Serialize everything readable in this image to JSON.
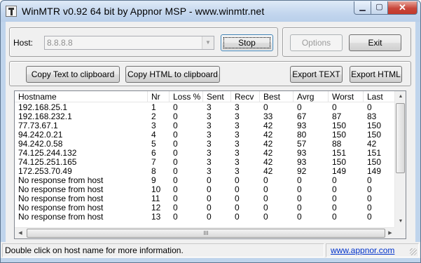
{
  "window": {
    "title": "WinMTR v0.92 64 bit by Appnor MSP - www.winmtr.net",
    "controls": {
      "minimize": "▁",
      "maximize": "▢",
      "close": "✕"
    }
  },
  "host": {
    "label": "Host:",
    "value": "8.8.8.8",
    "dropdown_arrow": "▼"
  },
  "buttons": {
    "stop": "Stop",
    "options": "Options",
    "exit": "Exit",
    "copy_text": "Copy Text to clipboard",
    "copy_html": "Copy HTML to clipboard",
    "export_text": "Export TEXT",
    "export_html": "Export HTML"
  },
  "table": {
    "columns": [
      "Hostname",
      "Nr",
      "Loss %",
      "Sent",
      "Recv",
      "Best",
      "Avrg",
      "Worst",
      "Last"
    ],
    "rows": [
      [
        "192.168.25.1",
        "1",
        "0",
        "3",
        "3",
        "0",
        "0",
        "0",
        "0"
      ],
      [
        "192.168.232.1",
        "2",
        "0",
        "3",
        "3",
        "33",
        "67",
        "87",
        "83"
      ],
      [
        "77.73.67.1",
        "3",
        "0",
        "3",
        "3",
        "42",
        "93",
        "150",
        "150"
      ],
      [
        "94.242.0.21",
        "4",
        "0",
        "3",
        "3",
        "42",
        "80",
        "150",
        "150"
      ],
      [
        "94.242.0.58",
        "5",
        "0",
        "3",
        "3",
        "42",
        "57",
        "88",
        "42"
      ],
      [
        "74.125.244.132",
        "6",
        "0",
        "3",
        "3",
        "42",
        "93",
        "151",
        "151"
      ],
      [
        "74.125.251.165",
        "7",
        "0",
        "3",
        "3",
        "42",
        "93",
        "150",
        "150"
      ],
      [
        "172.253.70.49",
        "8",
        "0",
        "3",
        "3",
        "42",
        "92",
        "149",
        "149"
      ],
      [
        "No response from host",
        "9",
        "0",
        "0",
        "0",
        "0",
        "0",
        "0",
        "0"
      ],
      [
        "No response from host",
        "10",
        "0",
        "0",
        "0",
        "0",
        "0",
        "0",
        "0"
      ],
      [
        "No response from host",
        "11",
        "0",
        "0",
        "0",
        "0",
        "0",
        "0",
        "0"
      ],
      [
        "No response from host",
        "12",
        "0",
        "0",
        "0",
        "0",
        "0",
        "0",
        "0"
      ],
      [
        "No response from host",
        "13",
        "0",
        "0",
        "0",
        "0",
        "0",
        "0",
        "0"
      ]
    ]
  },
  "scrollbars": {
    "up": "▲",
    "down": "▼",
    "left": "◀",
    "right": "▶",
    "grip": "III"
  },
  "status": {
    "text": "Double click on host name for more information.",
    "link": "www.appnor.com"
  }
}
